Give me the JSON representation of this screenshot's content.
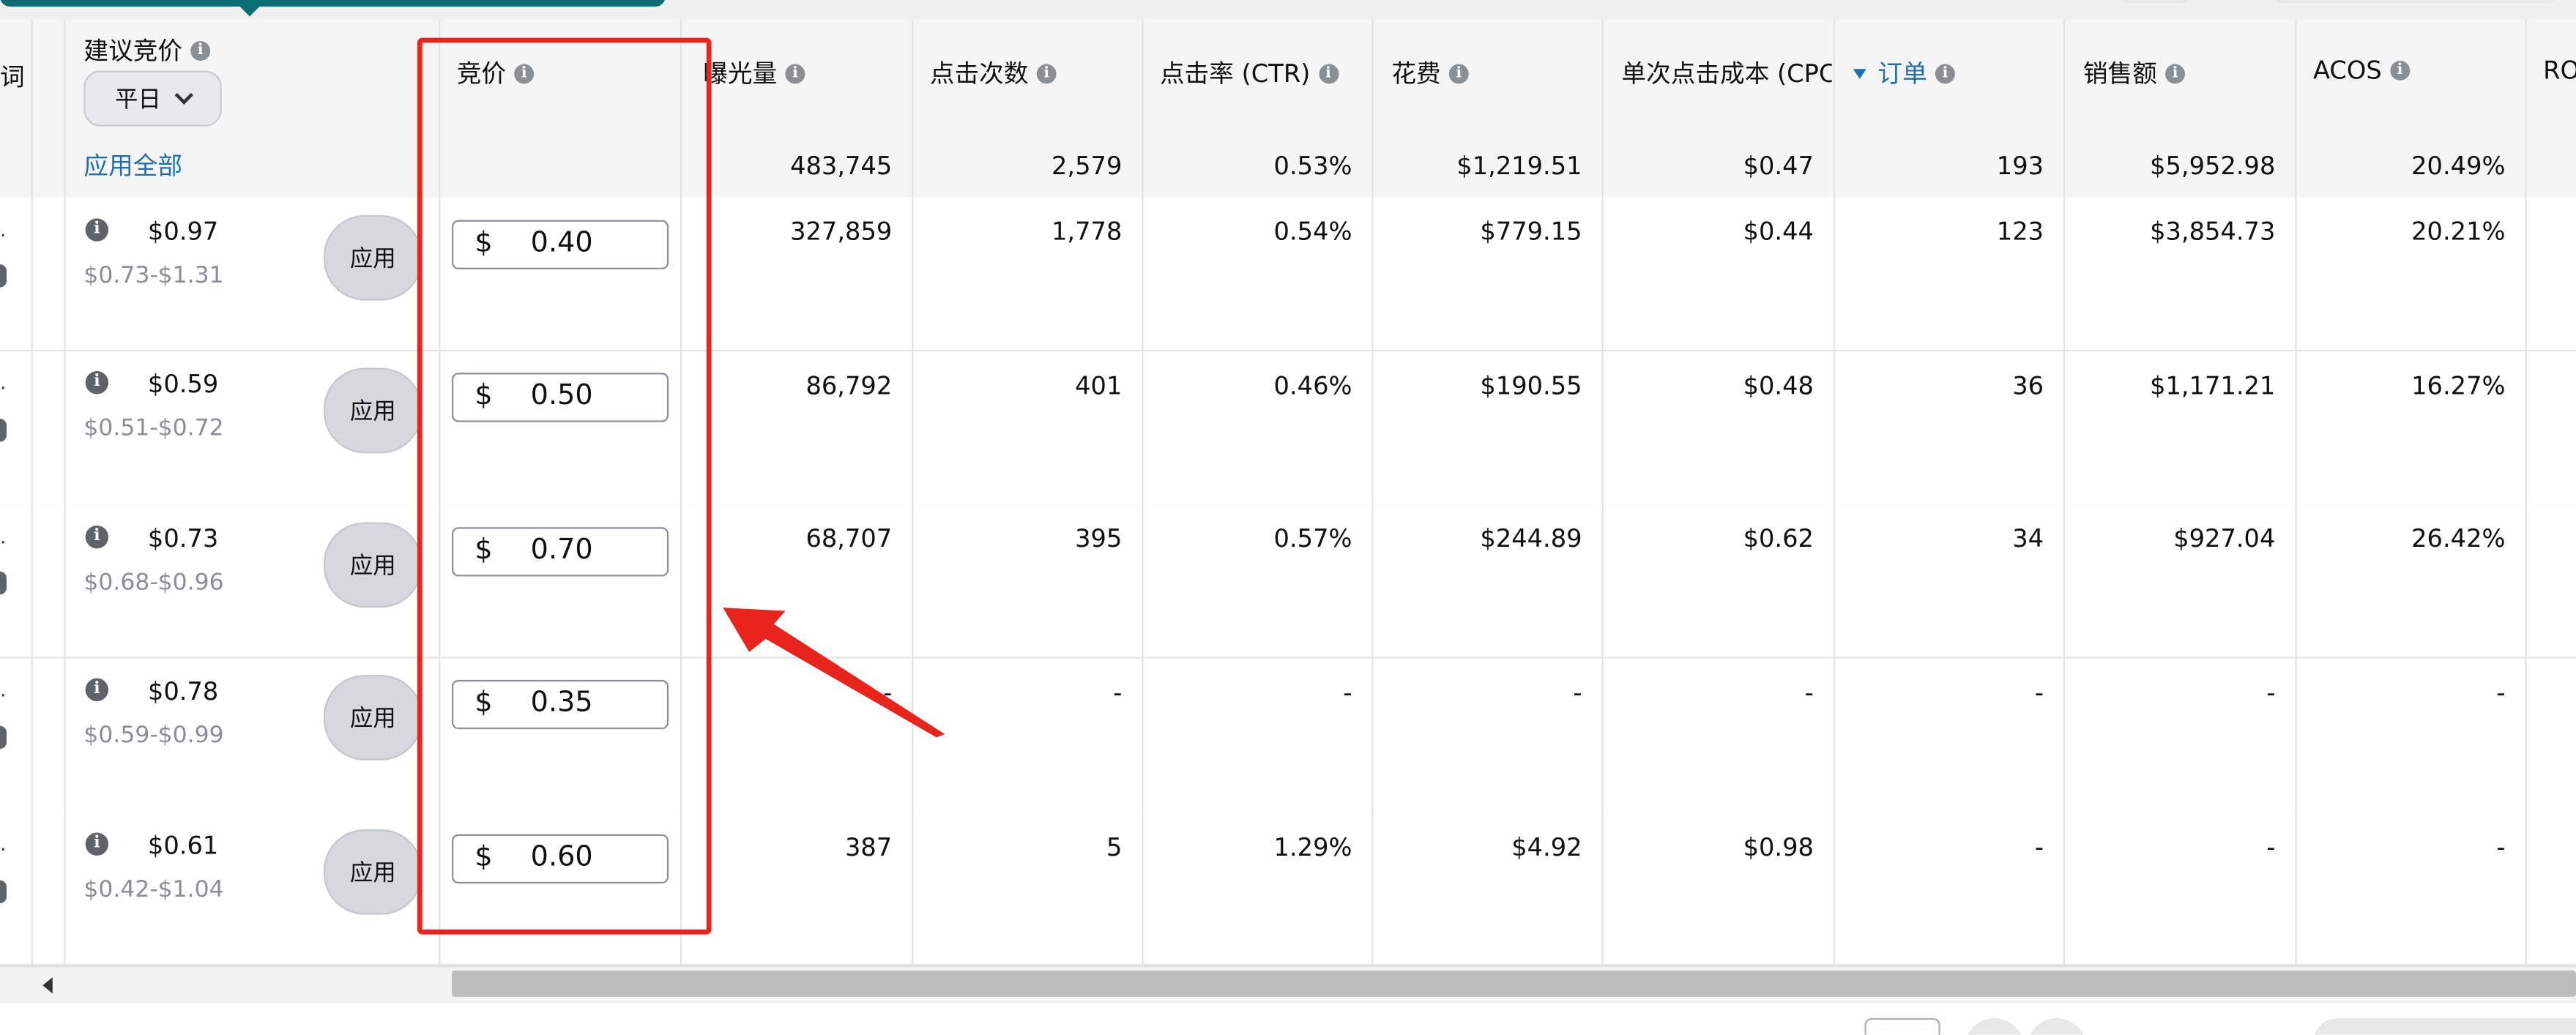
{
  "header": {
    "col_partial": "词",
    "suggested_bid": "建议竞价",
    "weekday_select": "平日",
    "bid": "竞价",
    "impressions": "曝光量",
    "clicks": "点击次数",
    "ctr": "点击率 (CTR)",
    "spend": "花费",
    "cpc": "单次点击成本 (CPC",
    "orders": "订单",
    "sales": "销售额",
    "acos": "ACOS",
    "roas_partial": "RO"
  },
  "summary": {
    "apply_all": "应用全部",
    "impressions": "483,745",
    "clicks": "2,579",
    "ctr": "0.53%",
    "spend": "$1,219.51",
    "cpc": "$0.47",
    "orders": "193",
    "sales": "$5,952.98",
    "acos": "20.49%"
  },
  "apply_label": "应用",
  "currency": "$",
  "rows": [
    {
      "suggested": "$0.97",
      "range": "$0.73-$1.31",
      "bid": "0.40",
      "impressions": "327,859",
      "clicks": "1,778",
      "ctr": "0.54%",
      "spend": "$779.15",
      "cpc": "$0.44",
      "orders": "123",
      "sales": "$3,854.73",
      "acos": "20.21%"
    },
    {
      "suggested": "$0.59",
      "range": "$0.51-$0.72",
      "bid": "0.50",
      "impressions": "86,792",
      "clicks": "401",
      "ctr": "0.46%",
      "spend": "$190.55",
      "cpc": "$0.48",
      "orders": "36",
      "sales": "$1,171.21",
      "acos": "16.27%"
    },
    {
      "suggested": "$0.73",
      "range": "$0.68-$0.96",
      "bid": "0.70",
      "impressions": "68,707",
      "clicks": "395",
      "ctr": "0.57%",
      "spend": "$244.89",
      "cpc": "$0.62",
      "orders": "34",
      "sales": "$927.04",
      "acos": "26.42%"
    },
    {
      "suggested": "$0.78",
      "range": "$0.59-$0.99",
      "bid": "0.35",
      "impressions": "-",
      "clicks": "-",
      "ctr": "-",
      "spend": "-",
      "cpc": "-",
      "orders": "-",
      "sales": "-",
      "acos": "-"
    },
    {
      "suggested": "$0.61",
      "range": "$0.42-$1.04",
      "bid": "0.60",
      "impressions": "387",
      "clicks": "5",
      "ctr": "1.29%",
      "spend": "$4.92",
      "cpc": "$0.98",
      "orders": "-",
      "sales": "-",
      "acos": "-"
    }
  ],
  "colors": {
    "highlight": "#e8241c",
    "link": "#1a6fb5",
    "tab": "#0a6f74"
  }
}
